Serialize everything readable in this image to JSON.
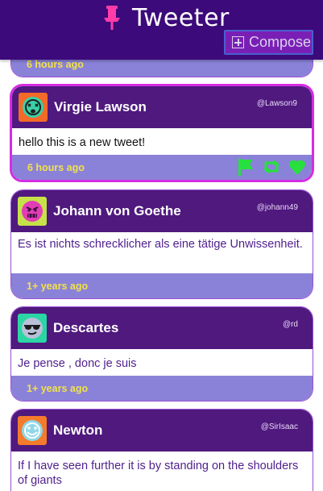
{
  "header": {
    "title": "Tweeter",
    "compose_label": "Compose"
  },
  "colors": {
    "header_bg": "#3c0a7a",
    "card_head": "#4f197e",
    "card_foot": "#8a82d8",
    "accent_pink": "#ff3ca8",
    "action_green": "#27e03d"
  },
  "tweets": [
    {
      "time": "6 hours ago"
    },
    {
      "name": "Virgie Lawson",
      "handle": "@Lawson9",
      "text": "hello this is a new tweet!",
      "time": "6 hours ago",
      "avatar_icon": "dizzy-face-icon"
    },
    {
      "name": "Johann von Goethe",
      "handle": "@johann49",
      "text": "Es ist nichts schrecklicher als eine tätige Unwissenheit.",
      "time": "1+ years ago",
      "avatar_icon": "angry-face-icon"
    },
    {
      "name": "Descartes",
      "handle": "@rd",
      "text": "Je pense , donc je suis",
      "time": "1+ years ago",
      "avatar_icon": "sunglasses-face-icon"
    },
    {
      "name": "Newton",
      "handle": "@SirIsaac",
      "text": "If I have seen further it is by standing on the shoulders of giants",
      "avatar_icon": "smiling-face-icon"
    }
  ]
}
